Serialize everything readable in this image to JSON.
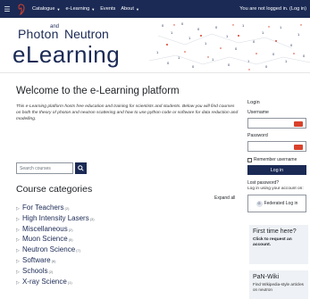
{
  "navbar": {
    "items": [
      {
        "label": "Catalogue",
        "has_caret": true
      },
      {
        "label": "e-Learning",
        "has_caret": true
      },
      {
        "label": "Events",
        "has_caret": false
      },
      {
        "label": "About",
        "has_caret": true
      }
    ],
    "login_status": "You are not logged in. (Log in)"
  },
  "brand": {
    "line1_left": "Photon",
    "line1_and": "and",
    "line1_right": "Neutron",
    "line2": "eLearning"
  },
  "main": {
    "welcome_title": "Welcome to the e-Learning platform",
    "welcome_text": "This e-Learning platform hosts free education and training for scientists and students. Below you will find courses on both the theory of photon and neutron scattering and how to use python code or software for data reduction and modelling.",
    "search_placeholder": "Search courses",
    "categories_title": "Course categories",
    "expand_all": "Expand all",
    "categories": [
      {
        "name": "For Teachers",
        "count": "(2)"
      },
      {
        "name": "High Intensity Lasers",
        "count": "(3)"
      },
      {
        "name": "Miscellaneous",
        "count": "(2)"
      },
      {
        "name": "Muon Science",
        "count": "(5)"
      },
      {
        "name": "Neutron Science",
        "count": "(7)"
      },
      {
        "name": "Software",
        "count": "(6)"
      },
      {
        "name": "Schools",
        "count": "(2)"
      },
      {
        "name": "X-ray Science",
        "count": "(1)"
      }
    ]
  },
  "login": {
    "title": "Login",
    "username_label": "Username",
    "password_label": "Password",
    "remember_label": "Remember username",
    "login_button": "Log in",
    "lost_password": "Lost password?",
    "account_note": "Log in using your account on:",
    "federated_button": "Federated Log in",
    "federated_icon_letter": "G"
  },
  "first_time": {
    "title": "First time here?",
    "link": "Click to request an account."
  },
  "pan_wiki": {
    "title": "PaN-Wiki",
    "text": "Find Wikipedia-style articles on neutron"
  },
  "colors": {
    "navbar": "#1b2a55",
    "accent": "#d9412b",
    "brand": "#1b2a55"
  }
}
